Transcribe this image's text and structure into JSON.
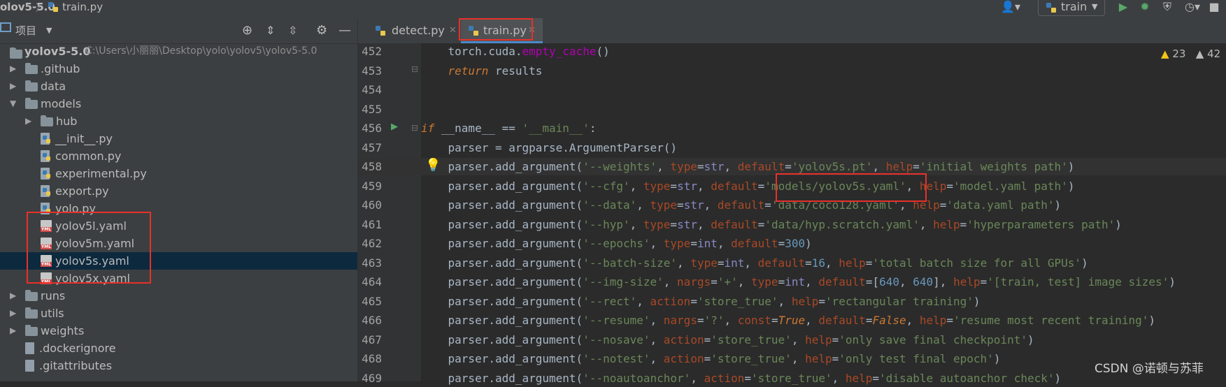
{
  "navbar": {
    "project_crumb": "olov5-5.0",
    "file_crumb": "train.py",
    "run_config": "train"
  },
  "project_panel": {
    "title": "项目",
    "root": {
      "name": "yolov5-5.0",
      "path": "C:\\Users\\小丽丽\\Desktop\\yolo\\yolov5\\yolov5-5.0"
    },
    "items": [
      {
        "label": ".github",
        "type": "folder",
        "expanded": false,
        "depth": 1
      },
      {
        "label": "data",
        "type": "folder",
        "expanded": false,
        "depth": 1
      },
      {
        "label": "models",
        "type": "folder",
        "expanded": true,
        "depth": 1
      },
      {
        "label": "hub",
        "type": "folder",
        "expanded": false,
        "depth": 2
      },
      {
        "label": "__init__.py",
        "type": "py",
        "depth": 2
      },
      {
        "label": "common.py",
        "type": "py",
        "depth": 2
      },
      {
        "label": "experimental.py",
        "type": "py",
        "depth": 2
      },
      {
        "label": "export.py",
        "type": "py",
        "depth": 2
      },
      {
        "label": "yolo.py",
        "type": "py",
        "depth": 2
      },
      {
        "label": "yolov5l.yaml",
        "type": "yml",
        "depth": 2
      },
      {
        "label": "yolov5m.yaml",
        "type": "yml",
        "depth": 2
      },
      {
        "label": "yolov5s.yaml",
        "type": "yml",
        "depth": 2,
        "selected": true
      },
      {
        "label": "yolov5x.yaml",
        "type": "yml",
        "depth": 2
      },
      {
        "label": "runs",
        "type": "folder",
        "expanded": false,
        "depth": 1
      },
      {
        "label": "utils",
        "type": "folder",
        "expanded": false,
        "depth": 1
      },
      {
        "label": "weights",
        "type": "folder",
        "expanded": false,
        "depth": 1
      },
      {
        "label": ".dockerignore",
        "type": "doc",
        "depth": 1
      },
      {
        "label": ".gitattributes",
        "type": "doc",
        "depth": 1
      }
    ]
  },
  "tabs": [
    {
      "label": "detect.py",
      "active": false
    },
    {
      "label": "train.py",
      "active": true
    }
  ],
  "inspections": {
    "warnings": "23",
    "weak_warnings": "42"
  },
  "code": {
    "lines": [
      {
        "no": "452",
        "html": "    torch.cuda.<span class=\"fn2\">empty_cache</span>()"
      },
      {
        "no": "453",
        "html": "    <span class=\"kwi\">return</span> results"
      },
      {
        "no": "454",
        "html": ""
      },
      {
        "no": "455",
        "html": ""
      },
      {
        "no": "456",
        "html": "<span class=\"kwi\">if</span> __name__ == <span class=\"str\">'__main__'</span>:"
      },
      {
        "no": "457",
        "html": "    parser = argparse.ArgumentParser()"
      },
      {
        "no": "458",
        "html": "    parser.add_argument(<span class=\"str\">'--weights'</span>, <span class=\"prm\">type</span>=<span class=\"bi\">str</span>, <span class=\"prm\">default</span>=<span class=\"str\">'yolov5s.pt'</span>, <span class=\"prm\">help</span>=<span class=\"str\">'initial weights path'</span>)"
      },
      {
        "no": "459",
        "html": "    parser.add_argument(<span class=\"str\">'--cfg'</span>, <span class=\"prm\">type</span>=<span class=\"bi\">str</span>, <span class=\"prm\">default</span>=<span class=\"str\">'models/yolov5s.yaml'</span>, <span class=\"prm\">help</span>=<span class=\"str\">'model.yaml path'</span>)"
      },
      {
        "no": "460",
        "html": "    parser.add_argument(<span class=\"str\">'--data'</span>, <span class=\"prm\">type</span>=<span class=\"bi\">str</span>, <span class=\"prm\">default</span>=<span class=\"str\">'data/coco128.yaml'</span>, <span class=\"prm\">help</span>=<span class=\"str\">'data.yaml path'</span>)"
      },
      {
        "no": "461",
        "html": "    parser.add_argument(<span class=\"str\">'--hyp'</span>, <span class=\"prm\">type</span>=<span class=\"bi\">str</span>, <span class=\"prm\">default</span>=<span class=\"str\">'data/hyp.scratch.yaml'</span>, <span class=\"prm\">help</span>=<span class=\"str\">'hyperparameters path'</span>)"
      },
      {
        "no": "462",
        "html": "    parser.add_argument(<span class=\"str\">'--epochs'</span>, <span class=\"prm\">type</span>=<span class=\"bi\">int</span>, <span class=\"prm\">default</span>=<span class=\"num\">300</span>)"
      },
      {
        "no": "463",
        "html": "    parser.add_argument(<span class=\"str\">'--batch-size'</span>, <span class=\"prm\">type</span>=<span class=\"bi\">int</span>, <span class=\"prm\">default</span>=<span class=\"num\">16</span>, <span class=\"prm\">help</span>=<span class=\"str\">'total batch size for all GPUs'</span>)"
      },
      {
        "no": "464",
        "html": "    parser.add_argument(<span class=\"str\">'--img-size'</span>, <span class=\"prm\">nargs</span>=<span class=\"str\">'+'</span>, <span class=\"prm\">type</span>=<span class=\"bi\">int</span>, <span class=\"prm\">default</span>=[<span class=\"num\">640</span>, <span class=\"num\">640</span>], <span class=\"prm\">help</span>=<span class=\"str\">'[train, test] image sizes'</span>)"
      },
      {
        "no": "465",
        "html": "    parser.add_argument(<span class=\"str\">'--rect'</span>, <span class=\"prm\">action</span>=<span class=\"str\">'store_true'</span>, <span class=\"prm\">help</span>=<span class=\"str\">'rectangular training'</span>)"
      },
      {
        "no": "466",
        "html": "    parser.add_argument(<span class=\"str\">'--resume'</span>, <span class=\"prm\">nargs</span>=<span class=\"str\">'?'</span>, <span class=\"prm\">const</span>=<span class=\"bool\">True</span>, <span class=\"prm\">default</span>=<span class=\"bool\">False</span>, <span class=\"prm\">help</span>=<span class=\"str\">'resume most recent training'</span>)"
      },
      {
        "no": "467",
        "html": "    parser.add_argument(<span class=\"str\">'--nosave'</span>, <span class=\"prm\">action</span>=<span class=\"str\">'store_true'</span>, <span class=\"prm\">help</span>=<span class=\"str\">'only save final checkpoint'</span>)"
      },
      {
        "no": "468",
        "html": "    parser.add_argument(<span class=\"str\">'--notest'</span>, <span class=\"prm\">action</span>=<span class=\"str\">'store_true'</span>, <span class=\"prm\">help</span>=<span class=\"str\">'only test final epoch'</span>)"
      },
      {
        "no": "469",
        "html": "    parser.add_argument(<span class=\"str\">'--noautoanchor'</span>, <span class=\"prm\">action</span>=<span class=\"str\">'store_true'</span>, <span class=\"prm\">help</span>=<span class=\"str\">'disable autoanchor check'</span>)"
      }
    ]
  },
  "watermark": "CSDN @诺顿与苏菲"
}
